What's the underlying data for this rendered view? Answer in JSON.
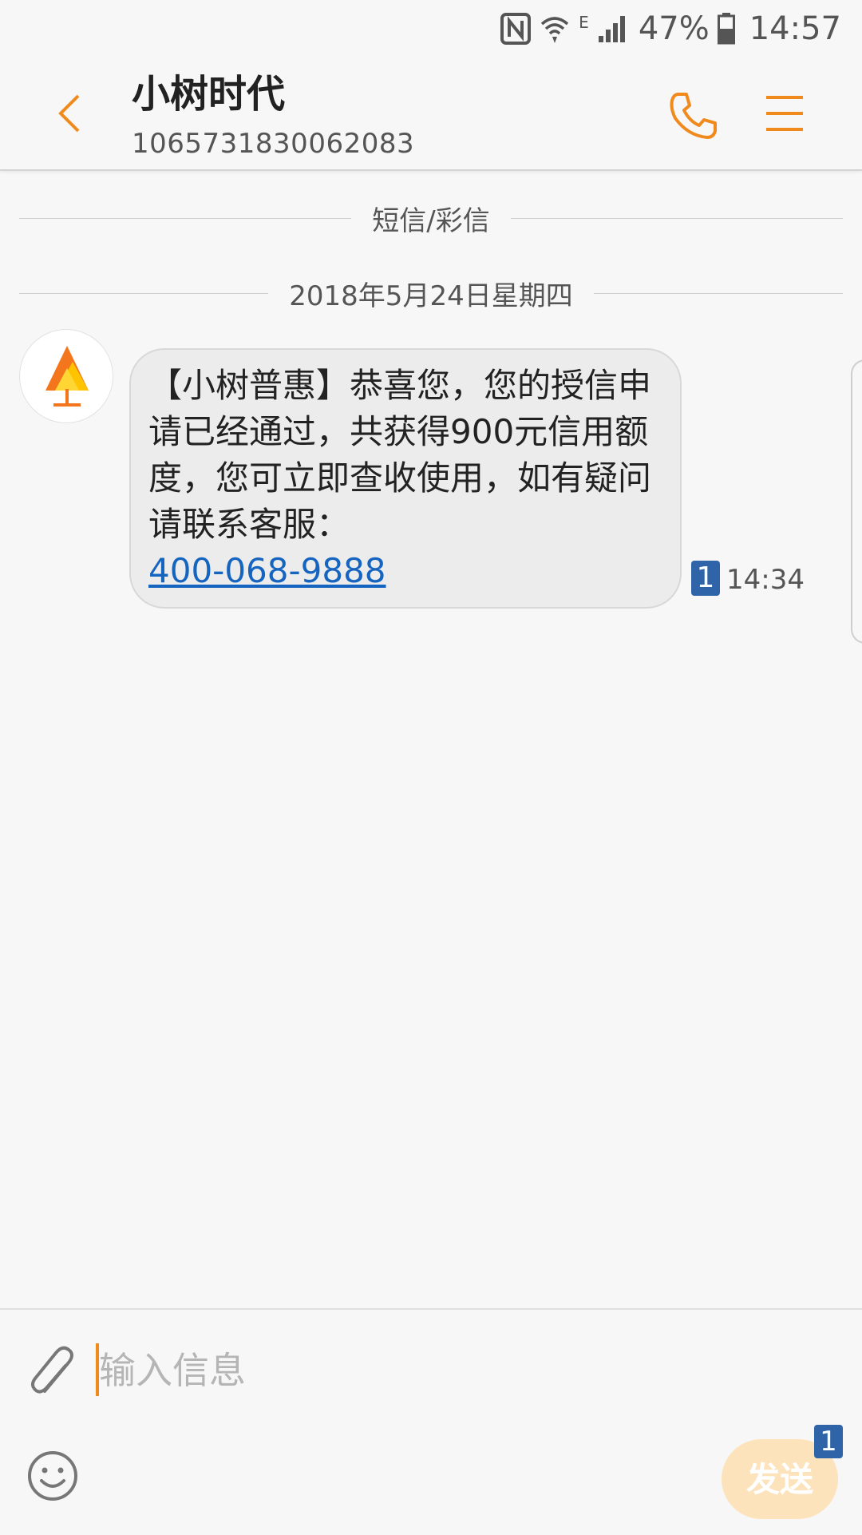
{
  "status_bar": {
    "battery_percent": "47%",
    "time": "14:57",
    "network_type": "E"
  },
  "header": {
    "contact_name": "小树时代",
    "contact_number": "1065731830062083"
  },
  "conversation": {
    "type_divider": "短信/彩信",
    "date_divider": "2018年5月24日星期四",
    "messages": [
      {
        "text": "【小树普惠】恭喜您，您的授信申请已经通过，共获得900元信用额度，您可立即查收使用，如有疑问请联系客服：",
        "link": "400-068-9888",
        "sim": "1",
        "time": "14:34"
      }
    ]
  },
  "composer": {
    "placeholder": "输入信息",
    "send_label": "发送",
    "send_sim": "1"
  },
  "colors": {
    "accent": "#F08A1C",
    "link": "#1565C0",
    "sim_badge": "#2F64A8",
    "send_button": "#FDE3BC"
  },
  "icons": {
    "back": "chevron-left-icon",
    "call": "phone-icon",
    "menu": "hamburger-menu-icon",
    "attach": "paperclip-icon",
    "emoji": "smiley-icon",
    "avatar": "orange-tree-logo-icon"
  }
}
